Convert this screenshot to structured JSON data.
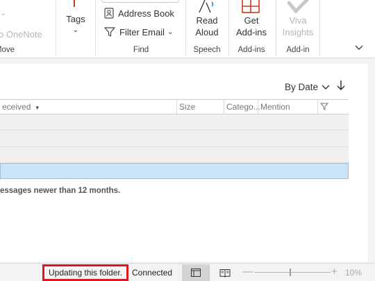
{
  "ribbon": {
    "onenote_label": "o OneNote",
    "move_group": "Move",
    "tags_label": "Tags",
    "address_book": "Address Book",
    "filter_email": "Filter Email",
    "find_group": "Find",
    "read_aloud_l1": "Read",
    "read_aloud_l2": "Aloud",
    "speech_group": "Speech",
    "get_addins_l1": "Get",
    "get_addins_l2": "Add-ins",
    "addins_group": "Add-ins",
    "viva_l1": "Viva",
    "viva_l2": "Insights",
    "addin_group": "Add-in",
    "accent_color": "#c43e1c"
  },
  "list": {
    "sort_label": "By Date",
    "columns": {
      "received": "eceived",
      "size": "Size",
      "category": "Catego...",
      "mention": "Mention"
    },
    "note": "essages newer than 12 months."
  },
  "status": {
    "updating": "Updating this folder.",
    "connected": "Connected",
    "zoom_minus": "—",
    "zoom_plus": "+",
    "zoom": "10%",
    "updating_border": "#e0151f"
  }
}
